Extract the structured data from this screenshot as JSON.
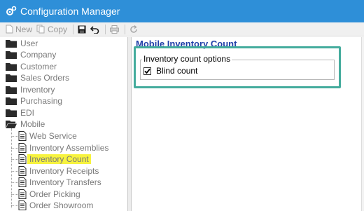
{
  "window": {
    "title": "Configuration Manager"
  },
  "toolbar": {
    "new_label": "New",
    "copy_label": "Copy"
  },
  "tree": {
    "folders": [
      {
        "label": "User"
      },
      {
        "label": "Company"
      },
      {
        "label": "Customer"
      },
      {
        "label": "Sales Orders"
      },
      {
        "label": "Inventory"
      },
      {
        "label": "Purchasing"
      },
      {
        "label": "EDI"
      },
      {
        "label": "Mobile"
      }
    ],
    "mobile_children": [
      {
        "label": "Web Service"
      },
      {
        "label": "Inventory Assemblies"
      },
      {
        "label": "Inventory Count",
        "selected": true
      },
      {
        "label": "Inventory Receipts"
      },
      {
        "label": "Inventory Transfers"
      },
      {
        "label": "Order Picking"
      },
      {
        "label": "Order Showroom"
      }
    ]
  },
  "content": {
    "page_title": "Mobile Inventory Count",
    "group_title": "Inventory count options",
    "blind_count": {
      "label": "Blind count",
      "checked": true
    }
  },
  "colors": {
    "titlebar": "#2e8fd8",
    "page_title": "#1f3fa8",
    "selection_highlight": "#f7f33f",
    "callout_border": "#45ac9d"
  }
}
